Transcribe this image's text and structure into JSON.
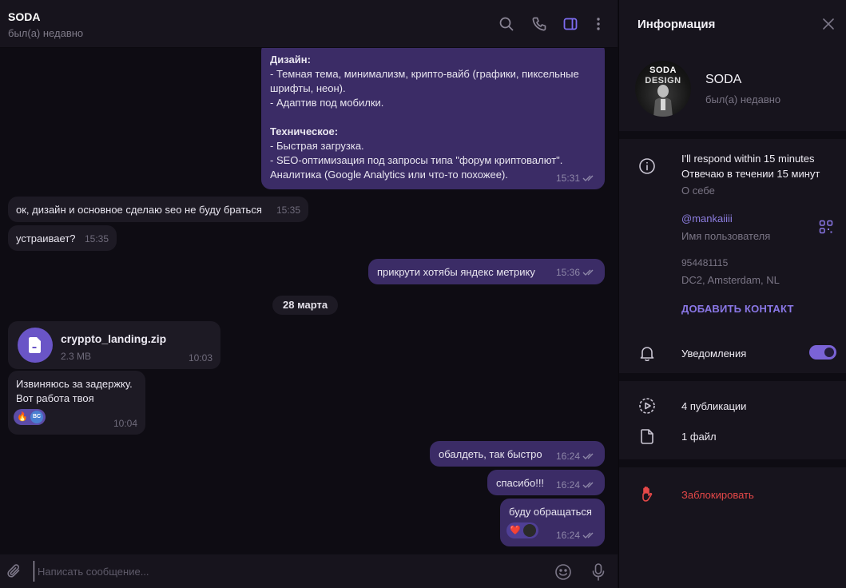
{
  "header": {
    "title": "SODA",
    "status": "был(а) недавно"
  },
  "messages": {
    "m1": {
      "line1": "Дизайн:",
      "line2": "- Темная тема, минимализм, крипто-вайб (графики, пиксельные шрифты, неон).",
      "line3": "- Адаптив под мобилки.",
      "line4": "Техническое:",
      "line5": "- Быстрая загрузка.",
      "line6": "- SEO-оптимизация под запросы типа \"форум криптовалют\". Аналитика (Google Analytics или что-то похожее).",
      "time": "15:31"
    },
    "m2": {
      "text": "ок, дизайн и основное сделаю seo не буду браться",
      "time": "15:35"
    },
    "m3": {
      "text": "устраивает?",
      "time": "15:35"
    },
    "m4": {
      "text": "прикрути хотябы яндекс метрику",
      "time": "15:36"
    },
    "date_divider": "28 марта",
    "m5": {
      "file_name": "cryppto_landing.zip",
      "file_size": "2.3 MB",
      "time": "10:03"
    },
    "m6": {
      "line1": "Извиняюсь за задержку.",
      "line2": "Вот работа твоя",
      "reaction_emoji": "🔥",
      "reaction_avatar_text": "BC",
      "time": "10:04"
    },
    "m7": {
      "text": "обалдеть, так быстро",
      "time": "16:24"
    },
    "m8": {
      "text": "спасибо!!!",
      "time": "16:24"
    },
    "m9": {
      "text": "буду обращаться",
      "reaction_emoji": "❤️",
      "time": "16:24"
    }
  },
  "composer": {
    "placeholder": "Написать сообщение..."
  },
  "info_panel": {
    "title": "Информация",
    "avatar_text_1": "SODA",
    "avatar_text_2": "DESIGN",
    "name": "SODA",
    "status": "был(а) недавно",
    "bio_line1": "I'll respond within 15 minutes",
    "bio_line2": "Отвечаю в течении 15 минут",
    "bio_label": "О себе",
    "username": "@mankaiiii",
    "username_label": "Имя пользователя",
    "phone": "954481115",
    "location": "DC2, Amsterdam, NL",
    "add_contact": "ДОБАВИТЬ КОНТАКТ",
    "notifications": "Уведомления",
    "notifications_on": true,
    "publications": "4 публикации",
    "files": "1 файл",
    "block": "Заблокировать"
  },
  "colors": {
    "outgoing_bubble": "#3b2c66",
    "incoming_bubble": "#1d1a24",
    "accent": "#8a77e6",
    "danger": "#e54848",
    "background": "#0e0c13",
    "panel": "#17141d"
  },
  "icons": {
    "header": [
      "search-icon",
      "phone-icon",
      "sidebar-toggle-icon",
      "more-vertical-icon"
    ],
    "panel": [
      "close-icon",
      "info-icon",
      "qr-code-icon",
      "bell-icon",
      "publications-icon",
      "file-icon",
      "hand-block-icon"
    ],
    "composer": [
      "attach-icon",
      "emoji-icon",
      "microphone-icon"
    ]
  }
}
